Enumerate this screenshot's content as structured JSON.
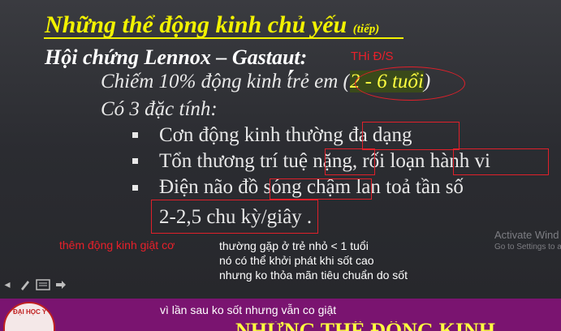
{
  "slide": {
    "title": "Những thể động kinh chủ yếu",
    "title_suffix": "(tiếp)",
    "subtitle": "Hội chứng Lennox – Gastaut:",
    "line1_prefix": "Chiếm 10% động kinh trẻ em (",
    "line1_highlight": "2 - 6 tuổi",
    "line1_suffix": ")",
    "line2": "Có 3 đặc tính:",
    "bullets": [
      {
        "a": "Cơn động kinh thường ",
        "b": "đa dạng"
      },
      {
        "a": "Tổn thương trí tuệ ",
        "b": "nặng",
        "c": ", rối loạn ",
        "d": "hành vi"
      },
      {
        "a": "Điện não đồ ",
        "b": "sóng chậm",
        "c": " lan toả tần số"
      }
    ],
    "bullet3_cont": "2-2,5 chu kỳ/giây",
    "bullet3_end": " ."
  },
  "annotations": {
    "thi_ds": "THi Đ/S",
    "red_note": "thêm động kinh giật cơ",
    "white_notes": [
      "thường gặp ở trẻ nhỏ < 1 tuổi",
      "nó có thể khởi phát khi sốt cao",
      "nhưng ko thỏa mãn tiêu chuẩn do sốt"
    ],
    "bottom_note": "vì lần sau ko sốt nhưng vẫn co giật"
  },
  "watermark": {
    "line1": "Activate Wind",
    "line2": "Go to Settings to a"
  },
  "toolbar": {
    "icons": [
      "pointer-icon",
      "pen-icon",
      "notes-icon",
      "next-arrow-icon"
    ]
  },
  "footer": {
    "logo_text": "ĐẠI HỌC Y",
    "partial_title": "NHỮNG THỂ ĐỘNG KINH"
  },
  "colors": {
    "title": "#f2f200",
    "annotation_red": "#e8202a",
    "footer_bar": "#7a1470"
  }
}
